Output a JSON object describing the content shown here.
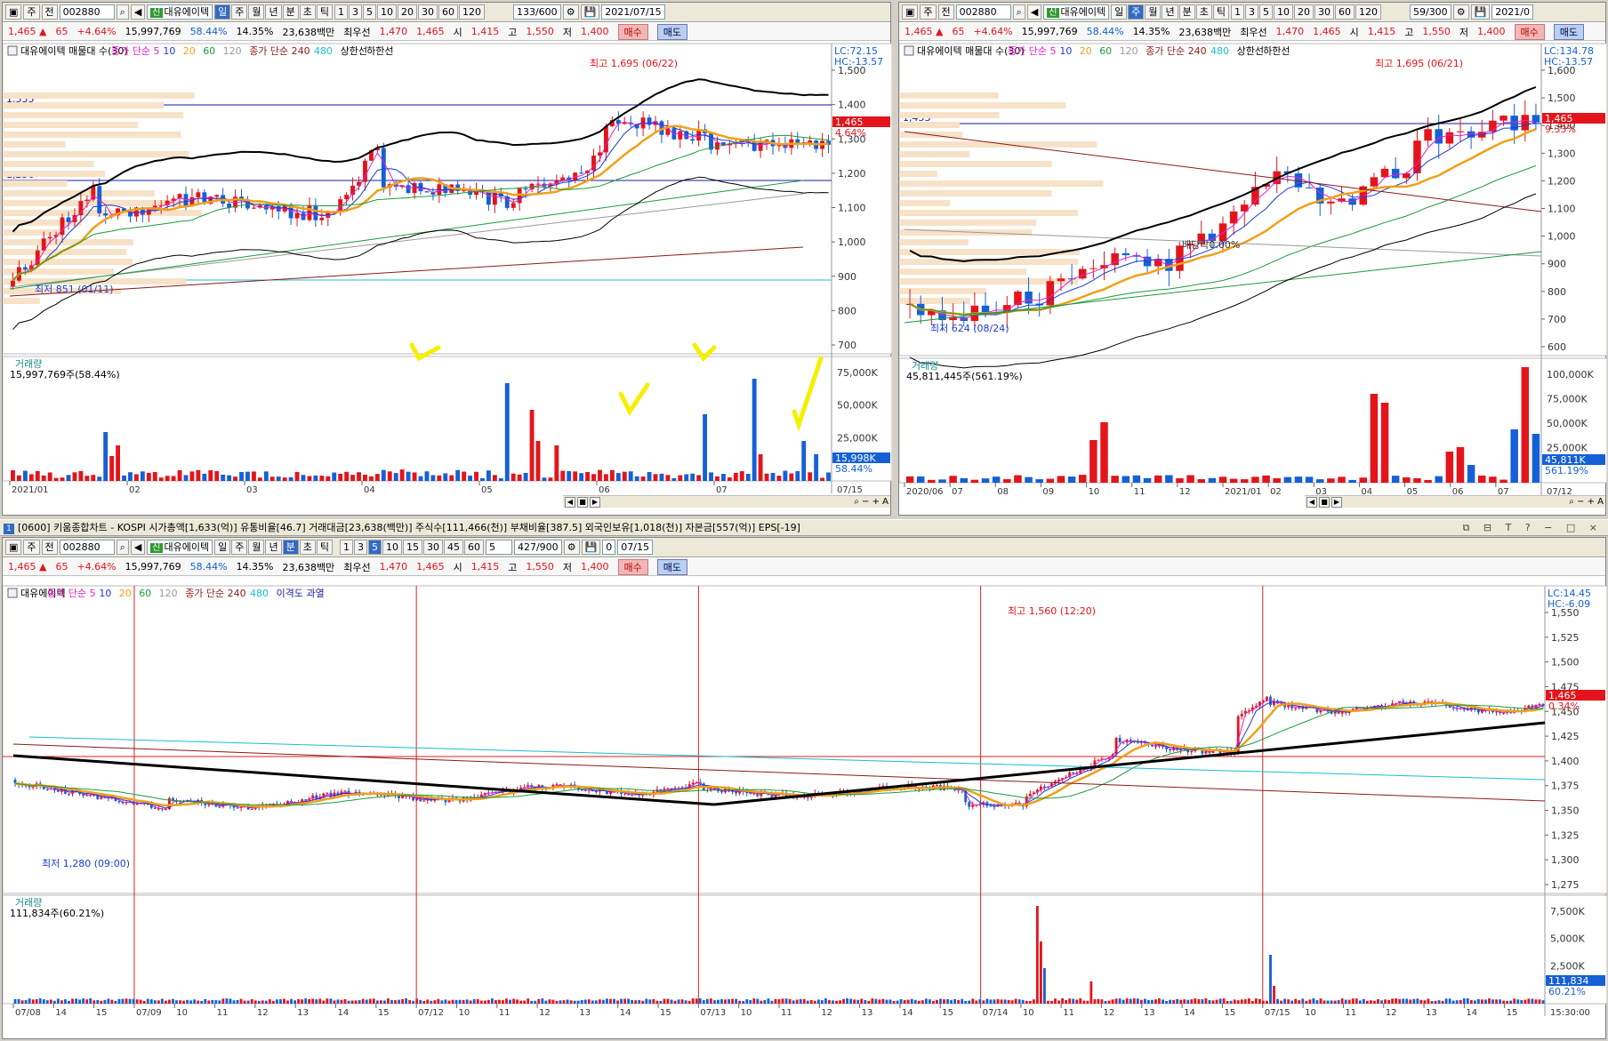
{
  "windows": {
    "daily": {
      "toolbar": {
        "type_btn": "주",
        "full_btn": "전",
        "code": "002880",
        "name": "대유에이텍",
        "periods": [
          "일",
          "주",
          "월",
          "년",
          "분",
          "초",
          "틱"
        ],
        "active_period": "일",
        "intervals": [
          "1",
          "3",
          "5",
          "10",
          "20",
          "30",
          "60",
          "120"
        ],
        "count": "133/600",
        "date": "2021/07/15"
      },
      "legend": [
        "대유에이텍 매물대 수(30)",
        "종가 단순 5",
        "10",
        "20",
        "60",
        "120",
        "종가 단순 240",
        "480",
        "상한선",
        "하한선"
      ],
      "annotations": {
        "high": "최고 1,695 (06/22)",
        "low": "최저 851 (01/11)",
        "level1": "1,535",
        "level2": "1,256",
        "lc": "LC:72.15",
        "hc": "HC:-13.57",
        "price": "1,465",
        "pct": "4.64%"
      },
      "y_ticks": [
        "1,500",
        "1,400",
        "1,300",
        "1,200",
        "1,100",
        "1,000",
        "900",
        "800",
        "700"
      ],
      "volume": {
        "label": "거래량",
        "value": "15,997,769주(58.44%)",
        "ticks": [
          "75,000K",
          "50,000K",
          "25,000K"
        ],
        "cur": "15,998K",
        "cur_pct": "58.44%"
      },
      "x_ticks": [
        "2021/01",
        "02",
        "03",
        "04",
        "05",
        "06",
        "07"
      ],
      "x_end": "07/15"
    },
    "weekly": {
      "toolbar": {
        "type_btn": "주",
        "full_btn": "전",
        "code": "002880",
        "name": "대유에이텍",
        "periods": [
          "일",
          "주",
          "월",
          "년",
          "분",
          "초",
          "틱"
        ],
        "active_period": "주",
        "intervals": [
          "1",
          "3",
          "5",
          "10",
          "20",
          "30",
          "60",
          "120"
        ],
        "count": "59/300",
        "date": "2021/0"
      },
      "legend": [
        "대유에이텍 매물대 수(30)",
        "종가 단순 5",
        "10",
        "20",
        "60",
        "120",
        "종가 단순 240",
        "480",
        "상한선",
        "하한선"
      ],
      "annotations": {
        "high": "최고 1,695 (06/21)",
        "low": "최저 624 (08/24)",
        "level1": "1,453",
        "dividend": "배당락0.00%",
        "lc": "LC:134.78",
        "hc": "HC:-13.57",
        "price": "1,465",
        "pct": "9.33%"
      },
      "y_ticks": [
        "1,600",
        "1,500",
        "1,400",
        "1,300",
        "1,200",
        "1,100",
        "1,000",
        "900",
        "800",
        "700",
        "600"
      ],
      "volume": {
        "label": "거래량",
        "value": "45,811,445주(561.19%)",
        "ticks": [
          "100,000K",
          "75,000K",
          "50,000K",
          "25,000K"
        ],
        "cur": "45,811K",
        "cur_pct": "561.19%"
      },
      "x_ticks": [
        "2020/06",
        "07",
        "08",
        "09",
        "10",
        "11",
        "12",
        "2021/01",
        "02",
        "03",
        "04",
        "05",
        "06",
        "07"
      ],
      "x_end": "07/12"
    },
    "minute": {
      "title": "[0600] 키움종합차트 - KOSPI 시가총액[1,633(억)] 유통비율[46.7] 거래대금[23,638(백만)] 주식수[111,466(천)] 부채비율[387.5] 외국인보유[1,018(천)] 자본금[557(억)] EPS[-19]",
      "title_num": "1",
      "toolbar": {
        "type_btn": "주",
        "full_btn": "전",
        "code": "002880",
        "name": "대유에이텍",
        "periods": [
          "일",
          "주",
          "월",
          "년",
          "분",
          "초",
          "틱"
        ],
        "active_period": "분",
        "intervals": [
          "1",
          "3",
          "5",
          "10",
          "15",
          "30",
          "45",
          "60"
        ],
        "active_interval": "5",
        "mult": "5",
        "count": "427/900",
        "flag": "0",
        "date": "07/15"
      },
      "legend": [
        "대유에이텍",
        "종가 단순 5",
        "10",
        "20",
        "60",
        "120",
        "종가 단순 240",
        "480",
        "이격도 과열"
      ],
      "annotations": {
        "high": "최고 1,560 (12:20)",
        "low": "최저 1,280 (09:00)",
        "lc": "LC:14.45",
        "hc": "HC:-6.09",
        "price": "1,465",
        "pct": "0.34%"
      },
      "y_ticks": [
        "1,550",
        "1,525",
        "1,500",
        "1,475",
        "1,450",
        "1,425",
        "1,400",
        "1,375",
        "1,350",
        "1,325",
        "1,300",
        "1,275"
      ],
      "volume": {
        "label": "거래량",
        "value": "111,834주(60.21%)",
        "ticks": [
          "7,500K",
          "5,000K",
          "2,500K"
        ],
        "cur": "111,834",
        "cur_pct": "60.21%"
      },
      "x_ticks": [
        "07/08",
        "14",
        "15",
        "07/09",
        "10",
        "11",
        "12",
        "13",
        "14",
        "15",
        "07/12",
        "10",
        "11",
        "12",
        "13",
        "14",
        "15",
        "07/13",
        "10",
        "11",
        "12",
        "13",
        "14",
        "15",
        "07/14",
        "10",
        "11",
        "12",
        "13",
        "14",
        "15",
        "07/15",
        "10",
        "11",
        "12",
        "13",
        "14",
        "15"
      ],
      "x_end": "15:30:00"
    }
  },
  "quote": {
    "price": "1,465",
    "arrow": "▲",
    "change": "65",
    "pct": "+4.64%",
    "volume": "15,997,769",
    "vol_ratio": "58.44%",
    "turnover": "14.35%",
    "amount": "23,638백만",
    "ask_label": "최우선",
    "ask": "1,470",
    "bid": "1,465",
    "open_label": "시",
    "open": "1,415",
    "high_label": "고",
    "high": "1,550",
    "low_label": "저",
    "low": "1,400",
    "buy": "매수",
    "sell": "매도"
  },
  "colors": {
    "up": "#e4141b",
    "down": "#1560d6",
    "ma5": "#e91ec8",
    "ma10": "#1a3cd6",
    "ma20": "#f0a018",
    "ma60": "#1c9a3c",
    "ma120": "#9a9a9a",
    "ma240": "#8b1a1a",
    "ma480": "#16c0d0"
  }
}
